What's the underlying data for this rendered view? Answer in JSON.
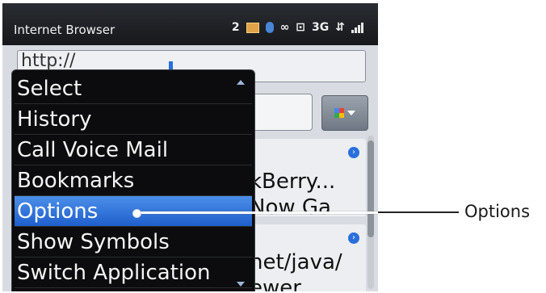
{
  "status_bar": {
    "app_title": "Internet Browser",
    "message_count": "2",
    "network": "3G",
    "icons": [
      "mail-icon",
      "bluetooth-icon",
      "voicemail-icon",
      "lock-icon",
      "data-arrows-icon",
      "signal-icon"
    ]
  },
  "browser": {
    "url_text": "http://",
    "panel1_lines": [
      "kBerry...",
      "Now Ga"
    ],
    "panel2_lines": [
      "net/java/",
      "ewer"
    ]
  },
  "menu": {
    "items": [
      {
        "label": "Select"
      },
      {
        "label": "History"
      },
      {
        "label": "Call Voice Mail"
      },
      {
        "label": "Bookmarks"
      },
      {
        "label": "Options"
      },
      {
        "label": "Show Symbols"
      },
      {
        "label": "Switch Application"
      }
    ],
    "selected_index": 4,
    "selected_color": "#2a6fdc"
  },
  "callout": {
    "label": "Options"
  }
}
